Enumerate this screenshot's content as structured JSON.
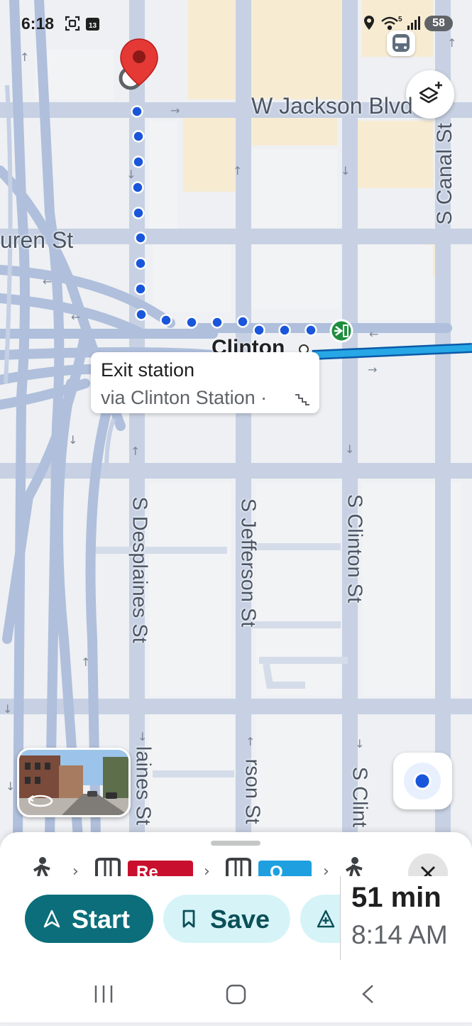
{
  "status_bar": {
    "time": "6:18",
    "notification_badge": "13",
    "wifi_badge": "5",
    "battery": "58"
  },
  "map": {
    "streets": {
      "w_jackson": "W Jackson Blvd",
      "s_canal": "S Canal St",
      "van_buren": "uren St",
      "clinton_station": "Clinton",
      "s_desplaines": "S Desplaines St",
      "s_jefferson": "S Jefferson St",
      "s_clinton": "S Clinton St",
      "s_desplaines_lower": "laines St",
      "s_jefferson_lower": "rson St",
      "s_clinton_lower": "S Clint"
    },
    "callout": {
      "title": "Exit station",
      "subtitle": "via Clinton Station ·"
    },
    "colors": {
      "route_dots": "#1a56db",
      "transit_line": "#1ea0e0",
      "roads": "#b3c2de",
      "destination_pin": "#e53935",
      "station_exit": "#1e8e3e"
    }
  },
  "bottom_sheet": {
    "steps": [
      {
        "type": "walk",
        "icon": "walk-icon"
      },
      {
        "type": "train",
        "icon": "train-icon",
        "line_label": "Re",
        "color": "#c8102e"
      },
      {
        "type": "train",
        "icon": "train-icon",
        "line_label": "O",
        "color": "#1ea0e0"
      },
      {
        "type": "walk",
        "icon": "walk-icon"
      }
    ],
    "start_label": "Start",
    "save_label": "Save",
    "eta": {
      "duration": "51 min",
      "arrival": "8:14 AM"
    }
  }
}
